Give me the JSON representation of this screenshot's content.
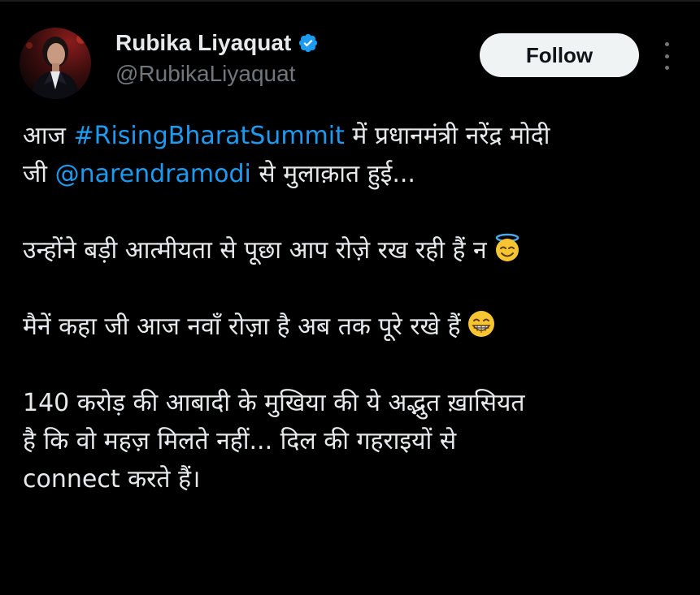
{
  "author": {
    "display_name": "Rubika Liyaquat",
    "handle": "@RubikaLiyaquat",
    "verified_icon": "verified-badge-icon",
    "avatar_icon": "avatar"
  },
  "actions": {
    "follow_label": "Follow",
    "more_icon": "more-options-icon"
  },
  "tweet": {
    "p1_a": "आज ",
    "p1_hashtag": "#RisingBharatSummit",
    "p1_b": " में प्रधानमंत्री नरेंद्र मोदी",
    "p1_c": "जी ",
    "p1_mention": "@narendramodi",
    "p1_d": " से मुलाक़ात हुई...",
    "p2": "उन्होंने बड़ी आत्मीयता से पूछा आप रोज़े रख रही हैं न",
    "p2_emoji": "smiling-face-with-halo-emoji",
    "p3": "मैनें कहा जी आज नवाँ रोज़ा है अब तक पूरे रखे हैं",
    "p3_emoji": "grinning-face-emoji",
    "p4_line1": "140 करोड़ की आबादी के मुखिया की ये अद्भुत ख़ासियत",
    "p4_line2": "है कि वो महज़ मिलते नहीं... दिल की गहराइयों से",
    "p4_line3": "connect करते हैं।"
  },
  "colors": {
    "background": "#000000",
    "text": "#e7e9ea",
    "secondary": "#71767b",
    "link": "#1d9bf0",
    "verified": "#1d9bf0",
    "follow_bg": "#eff3f4"
  }
}
